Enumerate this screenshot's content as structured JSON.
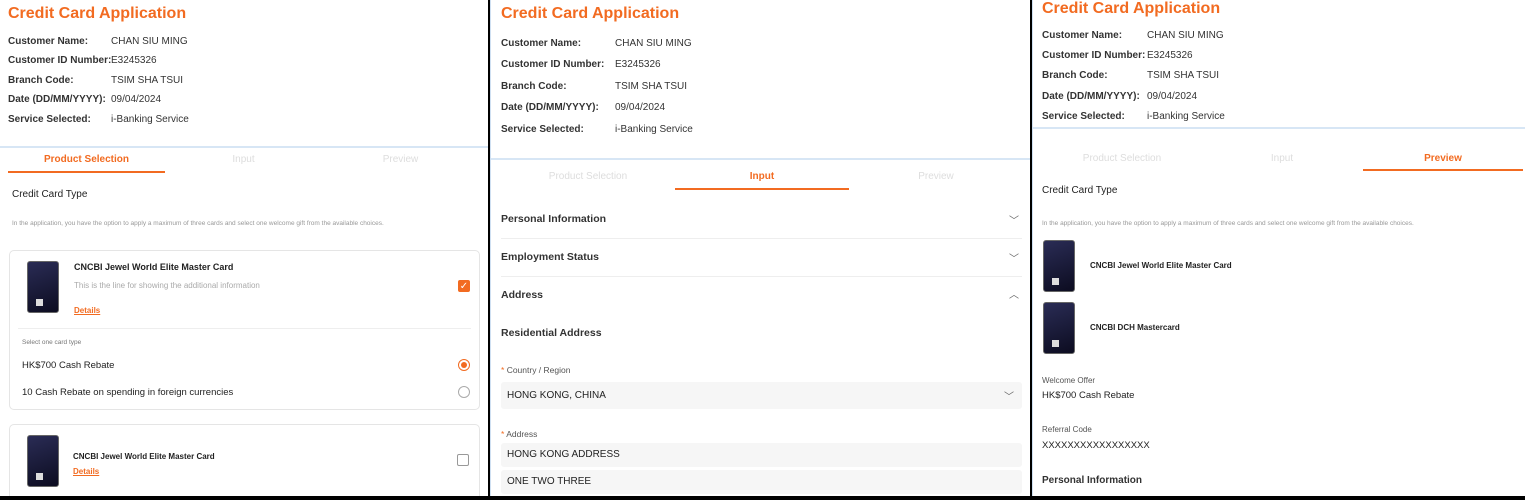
{
  "app_title": "Credit Card Application",
  "info": [
    {
      "label": "Customer Name:",
      "value": "CHAN SIU MING"
    },
    {
      "label": "Customer ID Number:",
      "value": "E3245326"
    },
    {
      "label": "Branch Code:",
      "value": "TSIM SHA TSUI"
    },
    {
      "label": "Date (DD/MM/YYYY):",
      "value": "09/04/2024"
    },
    {
      "label": "Service Selected:",
      "value": "i-Banking Service"
    }
  ],
  "tabs": [
    "Product Selection",
    "Input",
    "Preview"
  ],
  "product": {
    "section_title": "Credit Card Type",
    "description": "In the application, you have the option to apply a maximum of three cards and select one welcome gift from the available choices.",
    "card1": {
      "name": "CNCBI Jewel World Elite Master Card",
      "info": "This is the line for showing the additional information",
      "details": "Details",
      "checked": true,
      "select_label": "Select one card type",
      "options": [
        "HK$700 Cash Rebate",
        "10 Cash Rebate on spending in foreign currencies"
      ],
      "selected": 0
    },
    "card2": {
      "name": "CNCBI Jewel World Elite Master Card",
      "details": "Details",
      "checked": false
    }
  },
  "input": {
    "sections": [
      "Personal Information",
      "Employment Status",
      "Address"
    ],
    "residential_title": "Residential Address",
    "country_label": "Country / Region",
    "country_value": "HONG KONG, CHINA",
    "address_label": "Address",
    "address_line1": "HONG KONG ADDRESS",
    "address_line2": "ONE TWO THREE",
    "required_mark": "*"
  },
  "preview": {
    "section_title": "Credit Card Type",
    "description": "In the application, you have the option to apply a maximum of three cards and select one welcome gift from the available choices.",
    "cards": [
      "CNCBI Jewel World Elite Master Card",
      "CNCBI DCH Mastercard"
    ],
    "welcome_offer_label": "Welcome Offer",
    "welcome_offer_value": "HK$700 Cash Rebate",
    "referral_label": "Referral Code",
    "referral_value": "XXXXXXXXXXXXXXXXX",
    "personal_info_title": "Personal Information"
  }
}
